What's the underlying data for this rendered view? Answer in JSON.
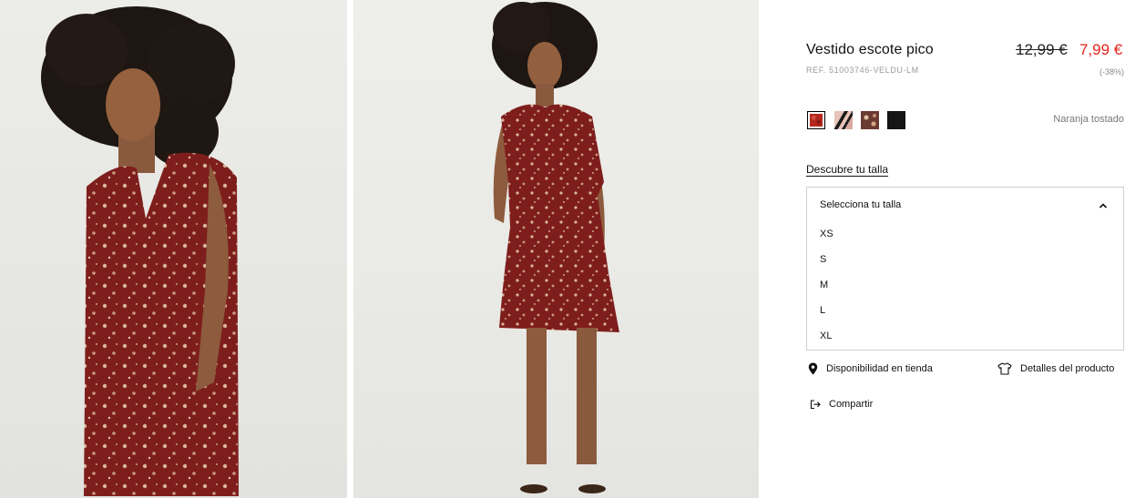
{
  "product": {
    "title": "Vestido escote pico",
    "ref": "REF. 51003746-VELDU-LM",
    "price_old": "12,99 €",
    "price_new": "7,99 €",
    "discount": "(-38%)"
  },
  "colors": {
    "selected_name": "Naranja tostado",
    "swatches": [
      {
        "name": "Naranja tostado",
        "hex": "#b3271f",
        "selected": true
      },
      {
        "name": "Rosa",
        "hex": "#d9a9a0",
        "selected": false
      },
      {
        "name": "Estampado",
        "hex": "#7b4a3e",
        "selected": false
      },
      {
        "name": "Negro",
        "hex": "#151515",
        "selected": false
      }
    ]
  },
  "size": {
    "guide_link": "Descubre tu talla",
    "placeholder": "Selecciona tu talla",
    "options": [
      "XS",
      "S",
      "M",
      "L",
      "XL"
    ]
  },
  "actions": {
    "store_availability": "Disponibilidad en tienda",
    "product_details": "Detalles del producto",
    "share": "Compartir"
  },
  "images": [
    {
      "name": "product-photo-front-closeup"
    },
    {
      "name": "product-photo-full-body"
    }
  ],
  "theme": {
    "sale_color": "#e2231a",
    "dress_color": "#7e1e1c"
  }
}
